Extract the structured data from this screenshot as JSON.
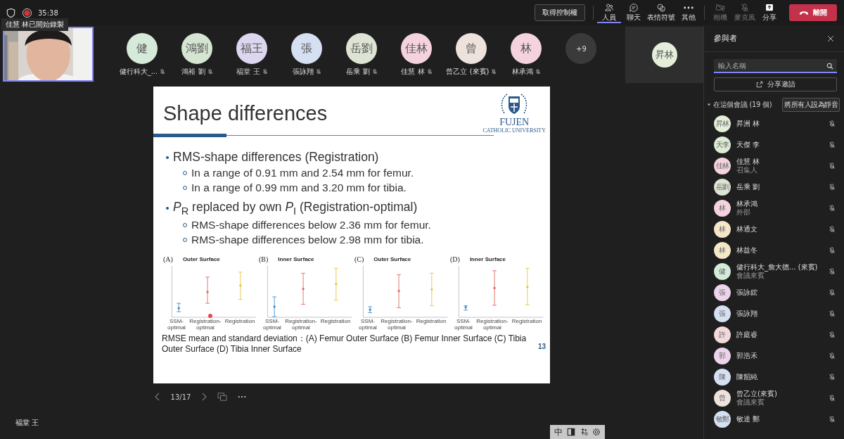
{
  "top_bar": {
    "timer": "35:38",
    "recording": true,
    "recording_toast": "佳慧 林已開始錄製",
    "control_button": "取得控制權",
    "tabs": [
      {
        "label": "人員",
        "selected": true
      },
      {
        "label": "聊天",
        "selected": false
      },
      {
        "label": "表情符號",
        "selected": false
      },
      {
        "label": "其他",
        "selected": false
      }
    ],
    "device_buttons": [
      {
        "label": "相機",
        "disabled": true
      },
      {
        "label": "麥克風",
        "disabled": true
      },
      {
        "label": "分享",
        "disabled": false
      }
    ],
    "leave_button": "離開"
  },
  "stage_avatars": [
    {
      "initials": "健",
      "name": "健行科大_...",
      "color": "#d5ead9",
      "muted": true
    },
    {
      "initials": "鴻劉",
      "name": "鴻裕 劉",
      "color": "#d5e5d2",
      "muted": true
    },
    {
      "initials": "福王",
      "name": "福堂 王",
      "color": "#dcd6ee",
      "muted": true
    },
    {
      "initials": "張",
      "name": "張詠翔",
      "color": "#d6e0f3",
      "muted": true
    },
    {
      "initials": "岳劉",
      "name": "岳乘 劉",
      "color": "#dde4d3",
      "muted": true
    },
    {
      "initials": "佳林",
      "name": "佳慧 林",
      "color": "#f4d3df",
      "muted": true
    },
    {
      "initials": "曾",
      "name": "曾乙立 (來賓)",
      "color": "#ede2dc",
      "muted": true
    },
    {
      "initials": "林",
      "name": "林承鴻",
      "color": "#f4d3df",
      "muted": true
    }
  ],
  "overflow_count": "+9",
  "spotlight_tile": {
    "initials": "昇林",
    "color": "#e4eed9"
  },
  "slide": {
    "title": "Shape differences",
    "logo_name": "FUJEN",
    "logo_subtitle": "CATHOLIC UNIVERSITY",
    "bullets": [
      {
        "text": "RMS-shape differences (Registration)",
        "children": [
          {
            "text": "In a range of 0.91 mm and 2.54 mm for femur."
          },
          {
            "text": "In a range of 0.99 mm and 3.20 mm for tibia."
          }
        ]
      },
      {
        "text": "*P*$_{R}$ replaced by own *P*$_{I}$ (Registration-optimal)",
        "children": [
          {
            "text": "RMS-shape differences below 2.36 mm for femur."
          },
          {
            "text": "RMS-shape differences below 2.98 mm for tibia."
          }
        ]
      }
    ],
    "figures": [
      {
        "letter": "(A)",
        "title": "Outer Surface",
        "x_labels": [
          "SSM-optimal",
          "Registration-optimal",
          "Registration"
        ]
      },
      {
        "letter": "(B)",
        "title": "Inner Surface",
        "x_labels": [
          "SSM-optimal",
          "Registration-optimal",
          "Registration"
        ]
      },
      {
        "letter": "(C)",
        "title": "Outer Surface",
        "x_labels": [
          "SSM-optimal",
          "Registration-optimal",
          "Registration"
        ]
      },
      {
        "letter": "(D)",
        "title": "Inner Surface",
        "x_labels": [
          "SSM-optimal",
          "Registration-optimal",
          "Registration"
        ]
      }
    ],
    "caption": "RMSE mean and standard deviation：(A) Femur Outer Surface (B) Femur Inner Surface (C) Tibia Outer Surface (D) Tibia Inner Surface",
    "page_number": "13"
  },
  "slide_nav": {
    "position": "13/17"
  },
  "presenter_label": "福堂 王",
  "ime_toolbar": {
    "mode": "中"
  },
  "panel": {
    "title": "參與者",
    "search_placeholder": "輸入名稱",
    "share_button": "分享邀請",
    "section": {
      "label": "在這個會議 (19 個)",
      "expanded": true,
      "mute_all_button": "將所有人設為靜音"
    },
    "participants": [
      {
        "initials": "昇林",
        "name": "昇洲 林",
        "color": "#e4eed9",
        "muted": true
      },
      {
        "initials": "天李",
        "name": "天傑 李",
        "color": "#dcebd3",
        "muted": true
      },
      {
        "initials": "佳林",
        "name": "佳慧 林",
        "role": "召集人",
        "color": "#f4d3df",
        "muted": true
      },
      {
        "initials": "岳劉",
        "name": "岳乘 劉",
        "color": "#dde4d3",
        "muted": true
      },
      {
        "initials": "林",
        "name": "林承鴻",
        "role": "外部",
        "color": "#f4d3df",
        "muted": true
      },
      {
        "initials": "林",
        "name": "林通文",
        "color": "#f5e8c8",
        "muted": true
      },
      {
        "initials": "林",
        "name": "林益冬",
        "color": "#f5e8c8",
        "muted": true
      },
      {
        "initials": "健",
        "name": "健行科大_詹大德... (來賓)",
        "role": "會議來賓",
        "color": "#d5ead9",
        "muted": true
      },
      {
        "initials": "張",
        "name": "張詠鋐",
        "color": "#ecd4ea",
        "muted": true
      },
      {
        "initials": "張",
        "name": "張詠翔",
        "color": "#d6e0f3",
        "muted": true
      },
      {
        "initials": "許",
        "name": "許庭睿",
        "color": "#f1d9dc",
        "muted": true
      },
      {
        "initials": "郭",
        "name": "郭浩禾",
        "color": "#ecd4ea",
        "muted": true
      },
      {
        "initials": "陳",
        "name": "陳韶純",
        "color": "#d6e0f3",
        "muted": true
      },
      {
        "initials": "曾",
        "name": "曾乙立(來賓)",
        "role": "會議來賓",
        "color": "#ede2dc",
        "muted": true
      },
      {
        "initials": "敏鄭",
        "name": "敏達 鄭",
        "color": "#d6e0f3",
        "muted": true
      }
    ]
  }
}
